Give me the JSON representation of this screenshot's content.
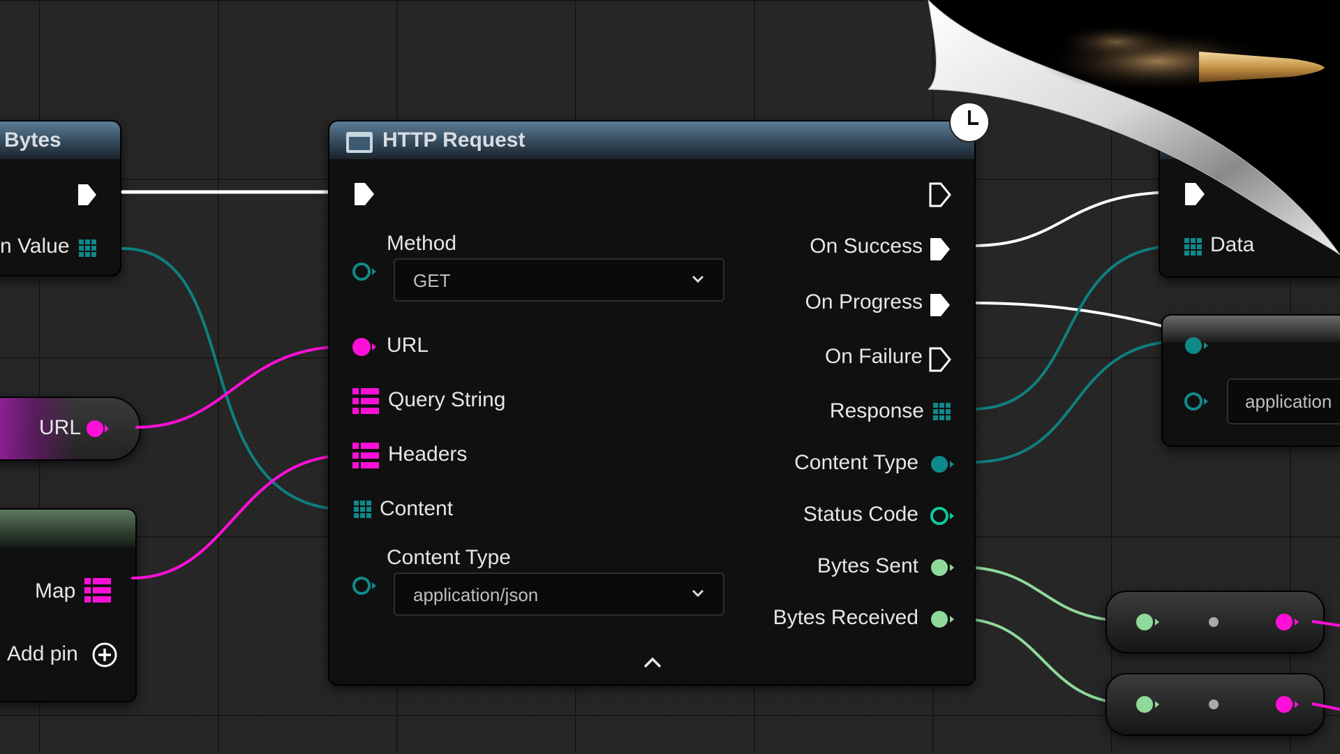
{
  "colors": {
    "background": "#262626",
    "exec": "#ffffff",
    "string_pin": "#ff10d8",
    "struct_pin": "#0f8a8a",
    "int_pin": "#10c8a0",
    "float_pin": "#8fd99a",
    "header_blue": "#3e5a70"
  },
  "left_node_bytes": {
    "title": "Bytes",
    "return_label": "n Value"
  },
  "left_node_url": {
    "label": "URL"
  },
  "left_node_map": {
    "map_label": "Map",
    "add_pin_label": "Add pin"
  },
  "http_node": {
    "title": "HTTP Request",
    "inputs": {
      "method_label": "Method",
      "method_value": "GET",
      "url_label": "URL",
      "query_label": "Query String",
      "headers_label": "Headers",
      "content_label": "Content",
      "content_type_label": "Content Type",
      "content_type_value": "application/json"
    },
    "outputs": {
      "on_success": "On Success",
      "on_progress": "On Progress",
      "on_failure": "On Failure",
      "response": "Response",
      "content_type": "Content Type",
      "status_code": "Status Code",
      "bytes_sent": "Bytes Sent",
      "bytes_received": "Bytes Received"
    }
  },
  "right_node_data": {
    "data_label": "Data"
  },
  "right_node_content": {
    "value": "application"
  },
  "icons": [
    "function-icon",
    "latent-clock-icon",
    "chevron-down-icon",
    "chevron-up-icon",
    "add-pin-icon",
    "exec-pin-icon",
    "array-pin-icon",
    "map-pin-icon",
    "bullet-image"
  ]
}
